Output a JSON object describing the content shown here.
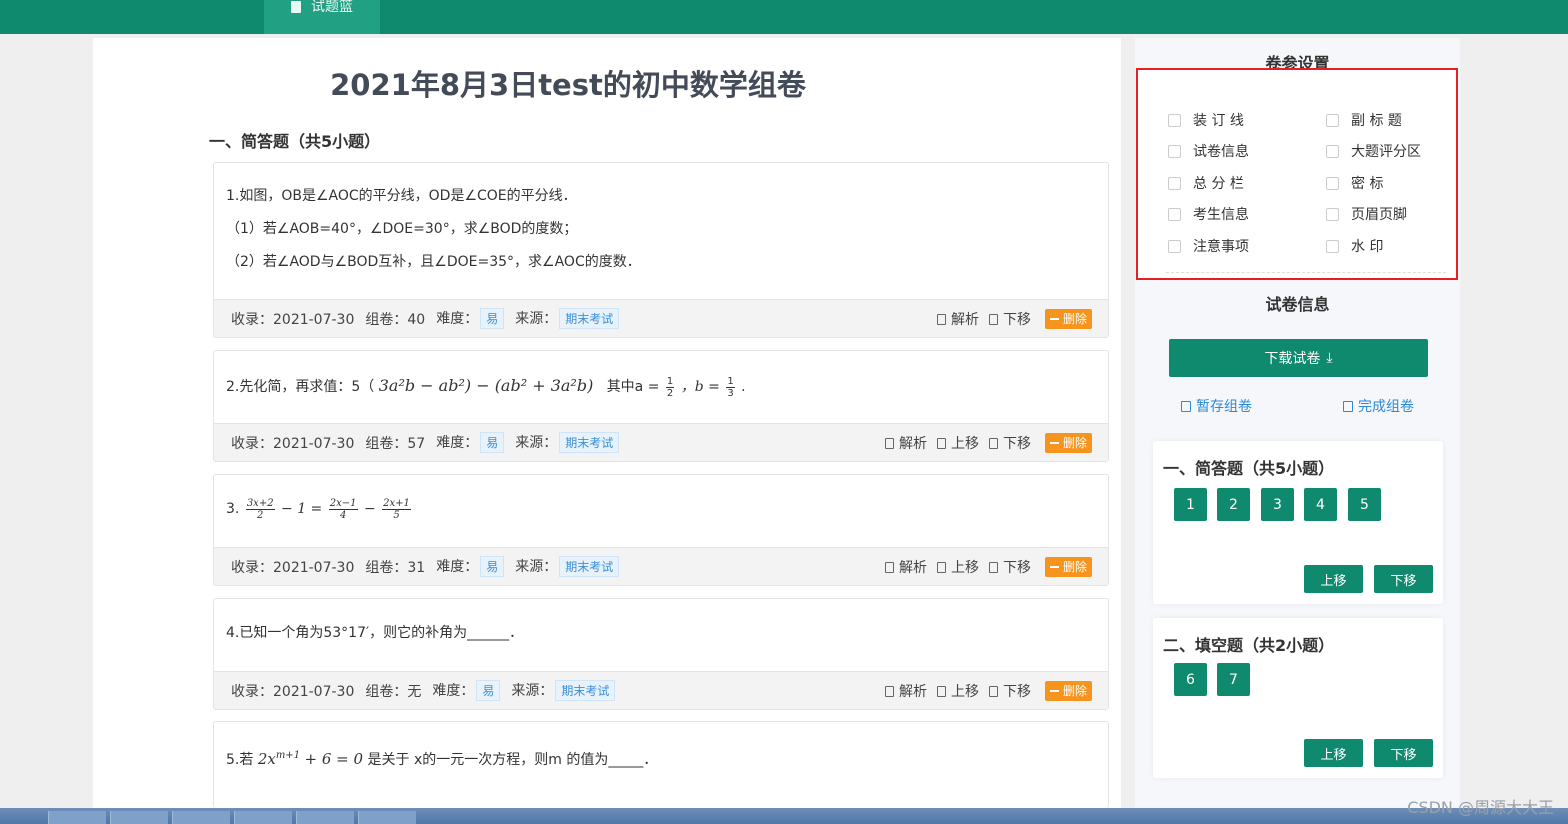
{
  "topbar": {
    "tab_label": "试题篮"
  },
  "paper": {
    "title": "2021年8月3日test的初中数学组卷",
    "section_heading": "一、简答题（共5小题）"
  },
  "labels": {
    "recorded": "收录：",
    "used": "组卷：",
    "difficulty": "难度：",
    "source": "来源：",
    "analysis": "解析",
    "move_up": "上移",
    "move_down": "下移",
    "delete": "删除"
  },
  "questions": [
    {
      "lines": [
        "1.如图，OB是∠AOC的平分线，OD是∠COE的平分线．",
        "（1）若∠AOB=40°，∠DOE=30°，求∠BOD的度数；",
        "（2）若∠AOD与∠BOD互补，且∠DOE=35°，求∠AOC的度数．"
      ],
      "date": "2021-07-30",
      "used": "40",
      "difficulty": "易",
      "source": "期末考试"
    },
    {
      "prefix": "2.先化简，再求值：5（",
      "expr": "3a²b − ab²) − (ab² + 3a²b)",
      "where": "其中a =",
      "a_num": "1",
      "a_den": "2",
      "b_label": "，b =",
      "b_num": "1",
      "b_den": "3",
      "end": ".",
      "date": "2021-07-30",
      "used": "57",
      "difficulty": "易",
      "source": "期末考试"
    },
    {
      "prefix": "3.",
      "f1_num": "3x+2",
      "f1_den": "2",
      "mid": "− 1 =",
      "f2_num": "2x−1",
      "f2_den": "4",
      "minus": "−",
      "f3_num": "2x+1",
      "f3_den": "5",
      "date": "2021-07-30",
      "used": "31",
      "difficulty": "易",
      "source": "期末考试"
    },
    {
      "lines": [
        "4.已知一个角为53°17′，则它的补角为______．"
      ],
      "date": "2021-07-30",
      "used": "无",
      "difficulty": "易",
      "source": "期末考试"
    },
    {
      "prefix": "5.若",
      "expr": "2x",
      "sup": "m+1",
      "expr_tail": "+ 6 = 0",
      "suffix": "是关于 x的一元一次方程，则m 的值为_____．"
    }
  ],
  "side": {
    "settings_title": "卷参设置",
    "settings_left": [
      "装 订 线",
      "试卷信息",
      "总 分 栏",
      "考生信息",
      "注意事项"
    ],
    "settings_right": [
      "副 标 题",
      "大题评分区",
      "密 标",
      "页眉页脚",
      "水 印"
    ],
    "info_title": "试卷信息",
    "download_label": "下载试卷",
    "save_label": "暂存组卷",
    "finish_label": "完成组卷",
    "group1": {
      "title": "一、简答题（共5小题）",
      "numbers": [
        "1",
        "2",
        "3",
        "4",
        "5"
      ]
    },
    "group2": {
      "title": "二、填空题（共2小题）",
      "numbers": [
        "6",
        "7"
      ]
    },
    "up_label": "上移",
    "down_label": "下移"
  },
  "watermark": "CSDN @周源大大王",
  "colors": {
    "primary": "#108a6f",
    "accent_orange": "#f7941d",
    "link_blue": "#2b8ad6",
    "highlight_red": "#e41f26"
  }
}
